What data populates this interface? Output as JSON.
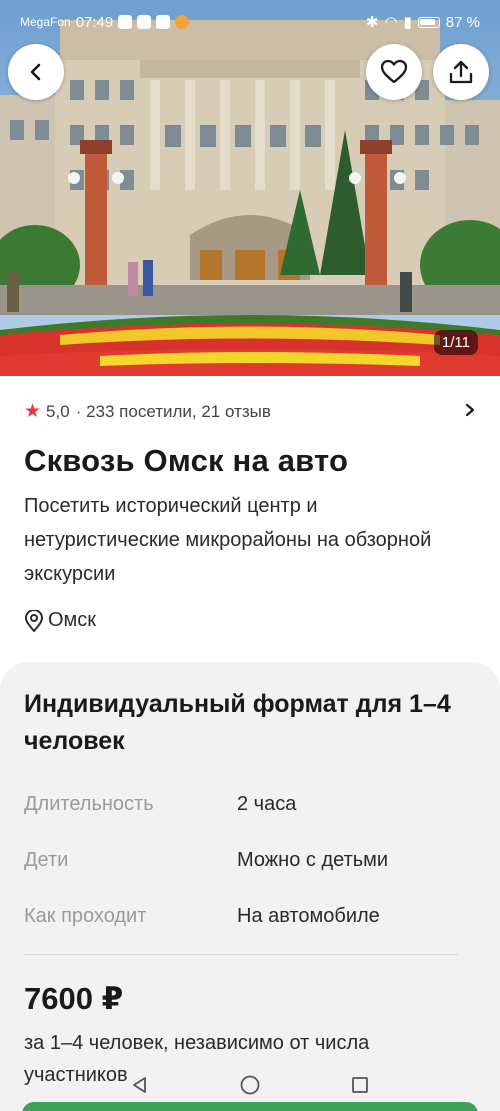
{
  "status_bar": {
    "carrier": "MegaFon",
    "time": "07:49",
    "battery": "87 %"
  },
  "hero": {
    "counter": "1/11",
    "back_icon": "chevron-left-icon",
    "favorite_icon": "heart-icon",
    "share_icon": "share-icon"
  },
  "info": {
    "rating": "5,0",
    "rating_meta": "· 233 посетили, 21 отзыв",
    "title": "Сквозь Омск на авто",
    "description": "Посетить исторический центр и нетуристические микрорайоны на обзорной экскурсии",
    "location": "Омск"
  },
  "format": {
    "title": "Индивидуальный формат для 1–4 человек",
    "props": [
      {
        "key": "Длительность",
        "value": "2 часа"
      },
      {
        "key": "Дети",
        "value": "Можно с детьми"
      },
      {
        "key": "Как проходит",
        "value": "На автомобиле"
      }
    ],
    "price": "7600 ₽",
    "price_note": "за 1–4 человек, независимо от числа участников"
  },
  "colors": {
    "accent_red": "#e23b3b",
    "cta_green": "#3ea45a",
    "card_bg": "#f2f2f2"
  }
}
